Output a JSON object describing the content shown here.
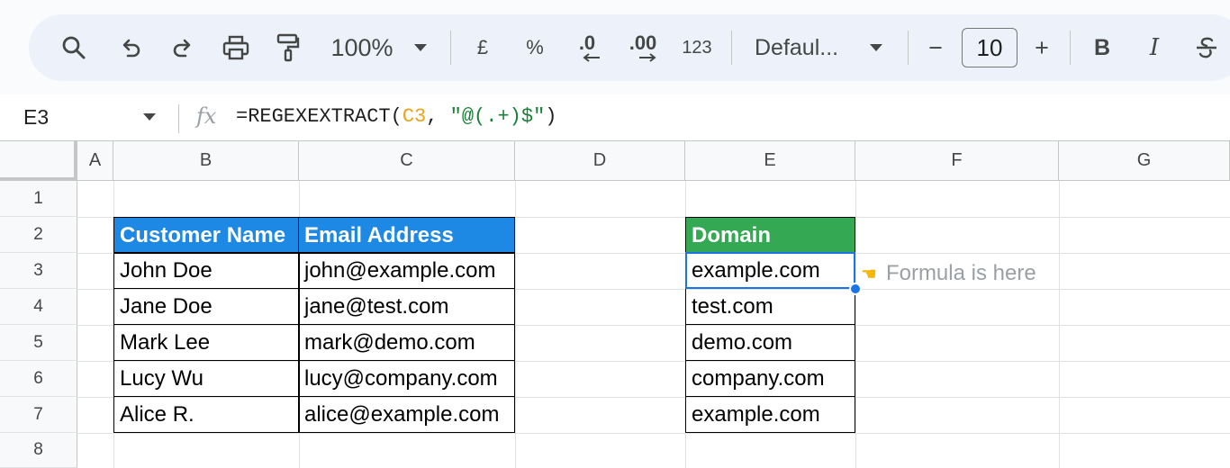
{
  "toolbar": {
    "zoom": "100%",
    "currency": "£",
    "percent": "%",
    "decrease_decimal": ".0",
    "increase_decimal": ".00",
    "number_format": "123",
    "font_name": "Defaul...",
    "font_size": "10",
    "bold": "B",
    "italic": "I",
    "minus": "−",
    "plus": "+"
  },
  "formula_bar": {
    "cell_ref": "E3",
    "fx": "fx",
    "formula_prefix": "=REGEXEXTRACT(",
    "formula_ref": "C3",
    "formula_mid": ", ",
    "formula_string": "\"@(.+)$\"",
    "formula_suffix": ")"
  },
  "columns": [
    "A",
    "B",
    "C",
    "D",
    "E",
    "F",
    "G"
  ],
  "rows": [
    "1",
    "2",
    "3",
    "4",
    "5",
    "6",
    "7",
    "8"
  ],
  "table": {
    "headers": [
      "Customer Name",
      "Email Address"
    ],
    "rows": [
      [
        "John Doe",
        "john@example.com"
      ],
      [
        "Jane Doe",
        "jane@test.com"
      ],
      [
        "Mark Lee",
        "mark@demo.com"
      ],
      [
        "Lucy Wu",
        "lucy@company.com"
      ],
      [
        "Alice R.",
        "alice@example.com"
      ]
    ]
  },
  "domain": {
    "header": "Domain",
    "values": [
      "example.com",
      "test.com",
      "demo.com",
      "company.com",
      "example.com"
    ]
  },
  "note": "Formula is here",
  "colors": {
    "blue_header": "#1e88e5",
    "green_header": "#34a853",
    "selection": "#1a73e8",
    "formula_ref": "#e8a317",
    "formula_string": "#188038"
  }
}
